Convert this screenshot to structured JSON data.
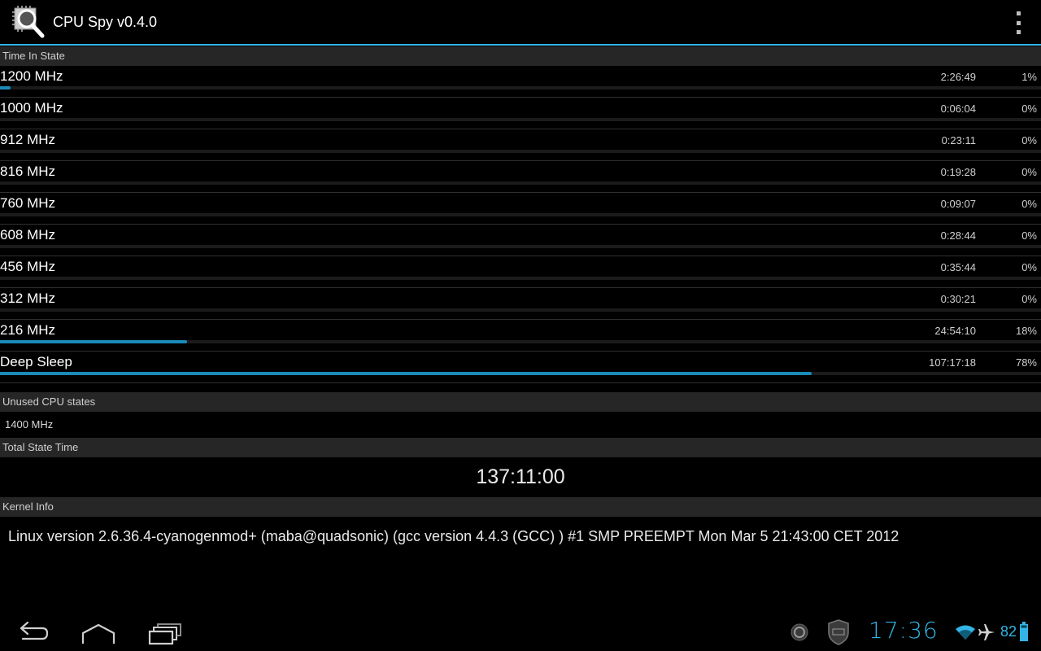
{
  "app": {
    "title": "CPU Spy v0.4.0",
    "icon": "cpu-magnifier-icon",
    "overflow_icon": "overflow-menu-icon"
  },
  "sections": {
    "time_in_state": "Time In State",
    "unused": "Unused CPU states",
    "total": "Total State Time",
    "kernel": "Kernel Info"
  },
  "states": [
    {
      "name": "1200 MHz",
      "time": "2:26:49",
      "percent": "1%",
      "fraction": 0.01
    },
    {
      "name": "1000 MHz",
      "time": "0:06:04",
      "percent": "0%",
      "fraction": 0
    },
    {
      "name": "912 MHz",
      "time": "0:23:11",
      "percent": "0%",
      "fraction": 0
    },
    {
      "name": "816 MHz",
      "time": "0:19:28",
      "percent": "0%",
      "fraction": 0
    },
    {
      "name": "760 MHz",
      "time": "0:09:07",
      "percent": "0%",
      "fraction": 0
    },
    {
      "name": "608 MHz",
      "time": "0:28:44",
      "percent": "0%",
      "fraction": 0
    },
    {
      "name": "456 MHz",
      "time": "0:35:44",
      "percent": "0%",
      "fraction": 0
    },
    {
      "name": "312 MHz",
      "time": "0:30:21",
      "percent": "0%",
      "fraction": 0
    },
    {
      "name": "216 MHz",
      "time": "24:54:10",
      "percent": "18%",
      "fraction": 0.18
    },
    {
      "name": "Deep Sleep",
      "time": "107:17:18",
      "percent": "78%",
      "fraction": 0.78
    }
  ],
  "unused_states": "1400 MHz",
  "total_state_time": "137:11:00",
  "kernel_info": "Linux version 2.6.36.4-cyanogenmod+ (maba@quadsonic) (gcc version 4.4.3 (GCC) ) #1 SMP PREEMPT Mon Mar 5 21:43:00 CET 2012",
  "system_bar": {
    "clock": "17:36",
    "battery": "82",
    "icons": [
      "back-icon",
      "home-icon",
      "recent-apps-icon",
      "notification-circle-icon",
      "lbe-shield-icon",
      "wifi-icon",
      "airplane-mode-icon",
      "battery-icon"
    ]
  },
  "colors": {
    "accent": "#33b5e5",
    "bar": "#1a8bb8",
    "header_bg": "#262626"
  }
}
